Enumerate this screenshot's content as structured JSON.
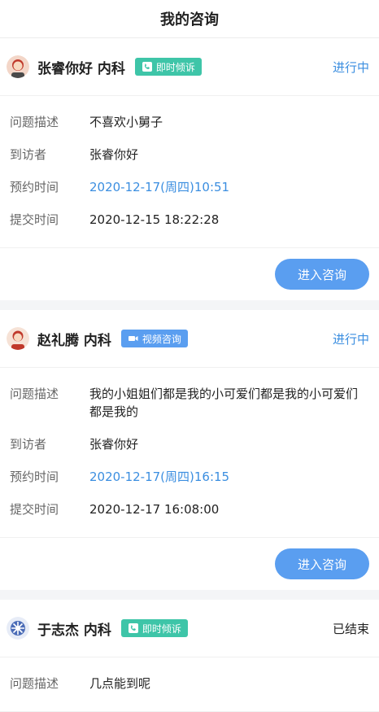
{
  "header": {
    "title": "我的咨询"
  },
  "cards": [
    {
      "doctor": "张睿你好 内科",
      "avatar_icon": "doctor-avatar-icon",
      "badge": {
        "label": "即时倾诉",
        "icon": "phone-icon",
        "color": "#3ec5a8"
      },
      "status": "进行中",
      "fields": [
        {
          "label": "问题描述",
          "value": "不喜欢小舅子"
        },
        {
          "label": "到访者",
          "value": "张睿你好"
        },
        {
          "label": "预约时间",
          "value": "2020-12-17(周四)10:51"
        },
        {
          "label": "提交时间",
          "value": "2020-12-15 18:22:28"
        }
      ],
      "button": "进入咨询"
    },
    {
      "doctor": "赵礼腾 内科",
      "avatar_icon": "doctor-avatar-icon",
      "badge": {
        "label": "视频咨询",
        "icon": "video-camera-icon",
        "color": "#5a9ef0"
      },
      "status": "进行中",
      "fields": [
        {
          "label": "问题描述",
          "value": "我的小姐姐们都是我的小可爱们都是我的小可爱们都是我的"
        },
        {
          "label": "到访者",
          "value": "张睿你好"
        },
        {
          "label": "预约时间",
          "value": "2020-12-17(周四)16:15"
        },
        {
          "label": "提交时间",
          "value": "2020-12-17 16:08:00"
        }
      ],
      "button": "进入咨询"
    },
    {
      "doctor": "于志杰 内科",
      "avatar_icon": "doctor-avatar-icon",
      "badge": {
        "label": "即时倾诉",
        "icon": "phone-icon",
        "color": "#3ec5a8"
      },
      "status": "已结束",
      "fields": [
        {
          "label": "问题描述",
          "value": "几点能到呢"
        }
      ]
    }
  ]
}
